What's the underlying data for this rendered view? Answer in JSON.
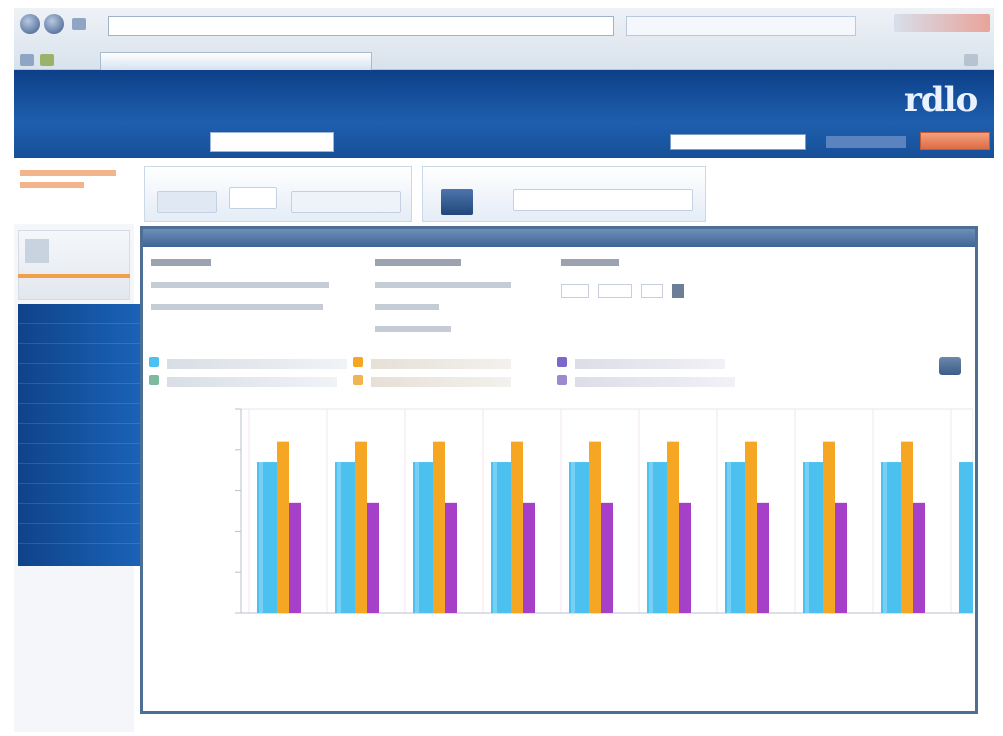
{
  "colors": {
    "chrome_bg": "#dfe7f0",
    "header_blue": "#1a56a3",
    "sidebar_blue": "#1a5eb0",
    "panel_border": "#4d6f96",
    "accent_orange": "#e27a4e",
    "series_cyan": "#4cc0ee",
    "series_orange": "#f5a623",
    "series_purple": "#a640c8"
  },
  "browser": {
    "address": "",
    "tab_title": ""
  },
  "header": {
    "logo": "rdlo",
    "app_name": "",
    "nav": [
      "",
      "",
      "",
      ""
    ],
    "search_placeholder": "",
    "action_label": ""
  },
  "icons": {
    "back": "back-icon",
    "forward": "forward-icon",
    "zoom": "zoom-icon",
    "calendar": "calendar-icon"
  },
  "chart_data": {
    "type": "bar",
    "categories": [
      "",
      "",
      "",
      "",
      "",
      "",
      "",
      "",
      ""
    ],
    "series": [
      {
        "values": [
          74,
          74,
          74,
          74,
          74,
          74,
          74,
          74,
          74
        ]
      },
      {
        "values": [
          84,
          84,
          84,
          84,
          84,
          84,
          84,
          84,
          84
        ]
      },
      {
        "values": [
          54,
          54,
          54,
          54,
          54,
          54,
          54,
          54,
          54
        ]
      }
    ],
    "ylim": [
      0,
      100
    ],
    "grid": true,
    "legend": "top"
  }
}
